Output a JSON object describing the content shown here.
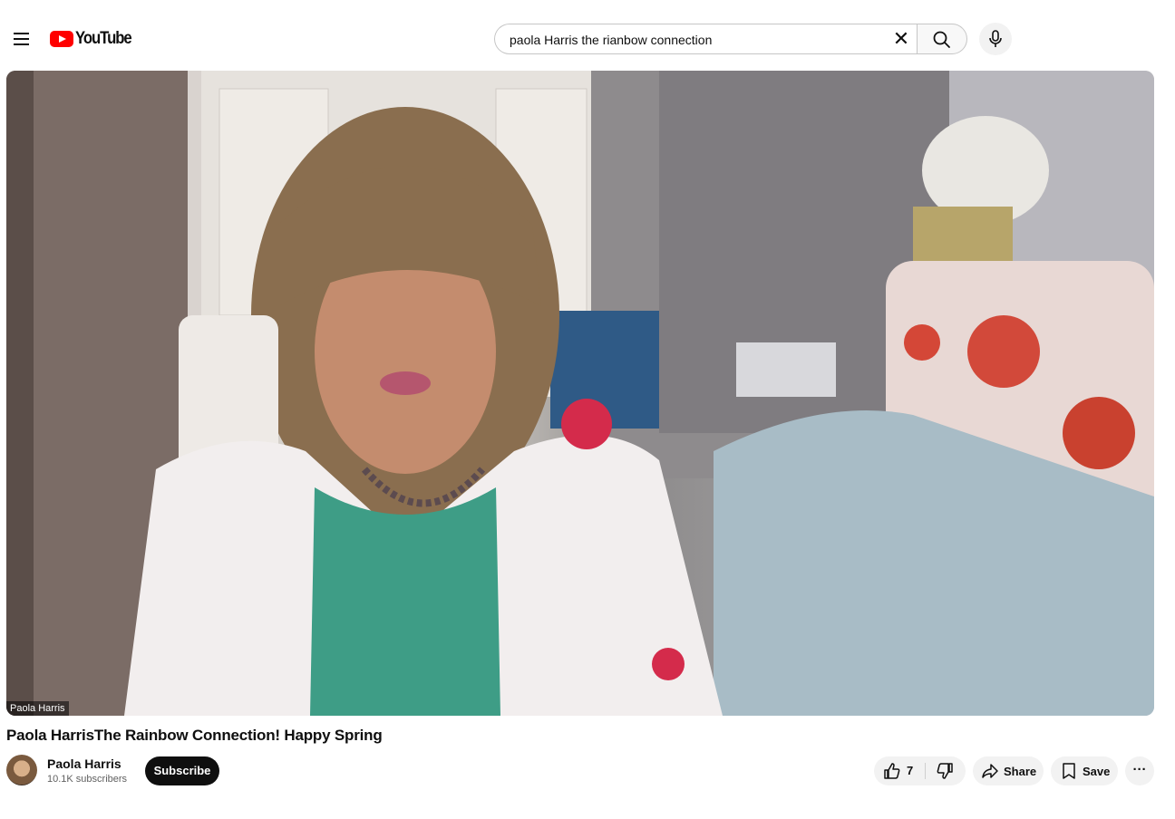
{
  "header": {
    "logo_text": "YouTube",
    "search": {
      "value": "paola Harris the rianbow connection",
      "clear_symbol": "✕"
    }
  },
  "video": {
    "overlay_caption": "Paola Harris"
  },
  "details": {
    "title": "Paola HarrisThe Rainbow Connection! Happy Spring",
    "channel": {
      "name": "Paola Harris",
      "subscribers": "10.1K subscribers"
    },
    "subscribe_label": "Subscribe",
    "actions": {
      "like_count": "7",
      "share_label": "Share",
      "save_label": "Save",
      "more_symbol": "···"
    }
  },
  "colors": {
    "brand_red": "#ff0000",
    "text_primary": "#0f0f0f",
    "text_secondary": "#606060",
    "pill_bg": "#f2f2f2"
  },
  "icons": [
    "menu-icon",
    "youtube-logo-icon",
    "clear-icon",
    "search-icon",
    "mic-icon",
    "thumbs-up-icon",
    "thumbs-down-icon",
    "share-icon",
    "bookmark-icon",
    "more-icon"
  ]
}
